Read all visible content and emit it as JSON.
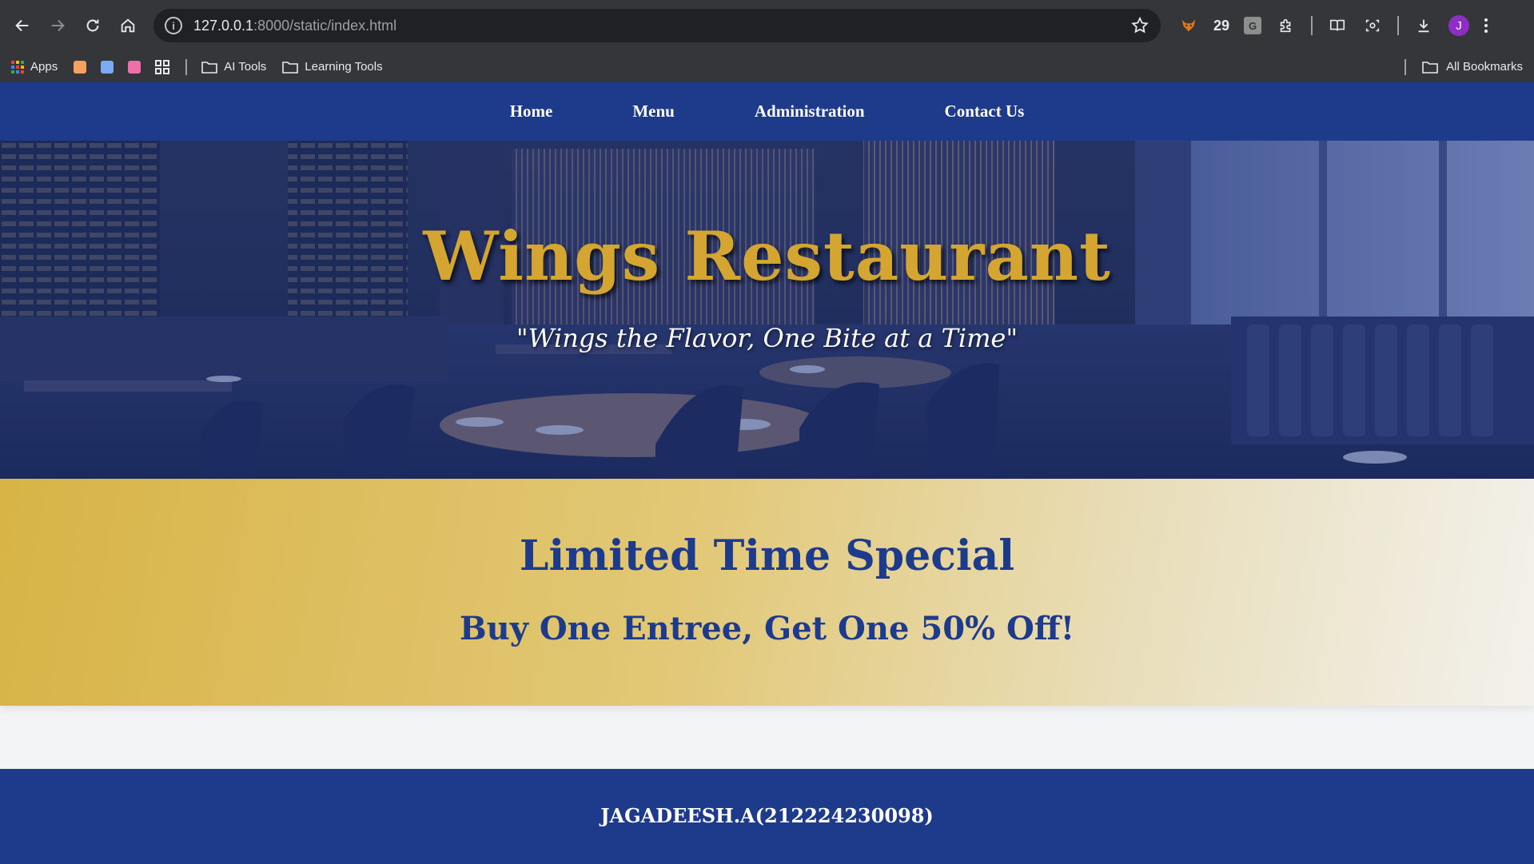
{
  "browser": {
    "url_host": "127.0.0.1",
    "url_path": ":8000/static/index.html",
    "extension_counter": "29",
    "ext_badge_letter": "G",
    "avatar_letter": "J",
    "icons": [
      "back-icon",
      "forward-icon",
      "reload-icon",
      "home-icon",
      "info-icon",
      "star-icon",
      "fox-icon",
      "puzzle-icon",
      "reader-icon",
      "screenshot-icon",
      "download-icon",
      "more-icon"
    ]
  },
  "bookmarks": {
    "apps_label": "Apps",
    "favicons": [
      "#f6a15d",
      "#7baaf7",
      "#ee6fa9"
    ],
    "folders": [
      {
        "label": "AI Tools"
      },
      {
        "label": "Learning Tools"
      }
    ],
    "all_label": "All Bookmarks"
  },
  "site": {
    "nav": [
      {
        "label": "Home"
      },
      {
        "label": "Menu"
      },
      {
        "label": "Administration"
      },
      {
        "label": "Contact Us"
      }
    ],
    "hero": {
      "title": "Wings Restaurant",
      "tagline": "\"Wings the Flavor, One Bite at a Time\""
    },
    "special": {
      "heading": "Limited Time Special",
      "offer": "Buy One Entree, Get One 50% Off!"
    },
    "footer": {
      "text": "JAGADEESH.A(212224230098)"
    },
    "colors": {
      "navy": "#1e3a8a",
      "gold": "#d4a531"
    }
  }
}
